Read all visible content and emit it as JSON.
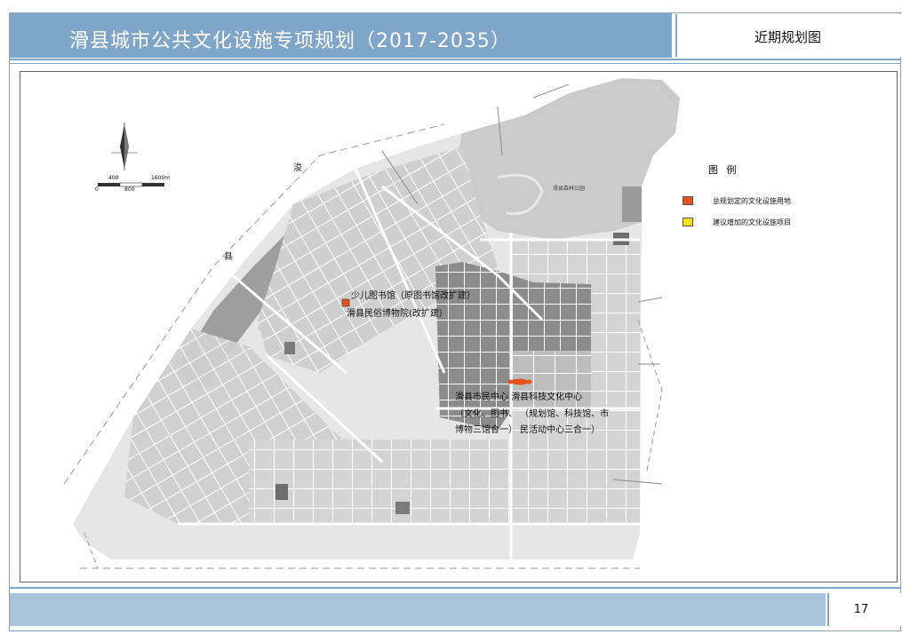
{
  "header": {
    "title": "滑县城市公共文化设施专项规划（2017-2035）",
    "subtitle": "近期规划图"
  },
  "legend": {
    "title": "图 例",
    "items": [
      {
        "label": "总规划定的文化设施用地",
        "color": "#e8531c"
      },
      {
        "label": "建议增加的文化设施项目",
        "color": "#f2e21a"
      }
    ]
  },
  "map": {
    "labels": {
      "library": "少儿图书馆（原图书馆改扩建）",
      "museum": "滑县民俗博物院(改扩建）",
      "civic_line1": "滑县市民中心     滑县科技文化中心",
      "civic_line2": "（文化、图书、   （规划馆、科技馆、市",
      "civic_line3": "博物三馆合一）   民活动中心三合一）",
      "park": "滑县森林公园",
      "river_a": "浚",
      "river_b": "县"
    },
    "scale": {
      "t1": "400",
      "t2": "1600m",
      "t0": "0",
      "t3": "800"
    },
    "marker_color": "#e8531c"
  },
  "footer": {
    "page": "17"
  }
}
